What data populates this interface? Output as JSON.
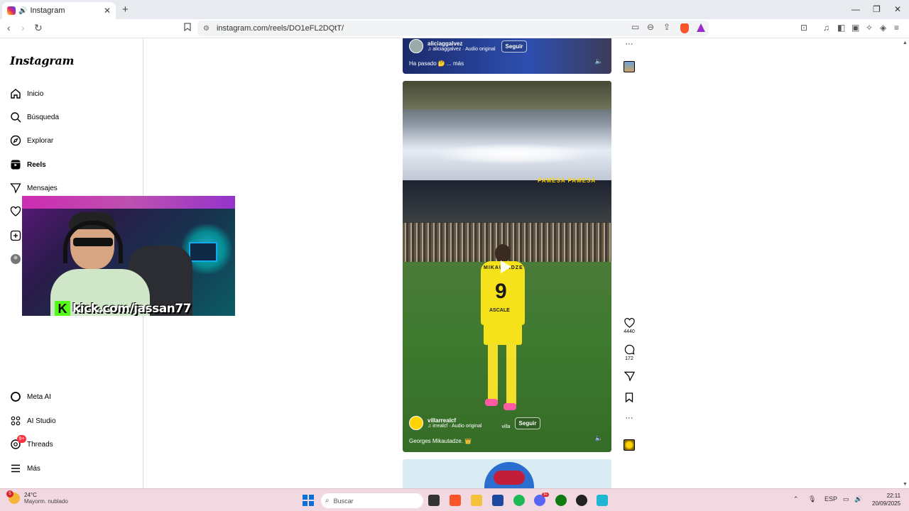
{
  "browser": {
    "tab_title": "Instagram",
    "url": "instagram.com/reels/DO1eFL2DQtT/",
    "new_tab_icon": "plus-icon",
    "accent": "#fb542b"
  },
  "sidebar": {
    "logo": "Instagram",
    "items": [
      {
        "label": "Inicio",
        "icon": "home-icon"
      },
      {
        "label": "Búsqueda",
        "icon": "search-icon"
      },
      {
        "label": "Explorar",
        "icon": "compass-icon"
      },
      {
        "label": "Reels",
        "icon": "reels-icon"
      },
      {
        "label": "Mensajes",
        "icon": "send-icon"
      }
    ],
    "bottom_items": [
      {
        "label": "Meta AI",
        "icon": "meta-ai-icon"
      },
      {
        "label": "AI Studio",
        "icon": "ai-studio-icon"
      },
      {
        "label": "Threads",
        "icon": "threads-icon",
        "badge": "9+"
      },
      {
        "label": "Más",
        "icon": "menu-icon"
      }
    ]
  },
  "overlay": {
    "kick_text": "kick.com/jassan77",
    "kick_color": "#53fc18"
  },
  "reels": {
    "top": {
      "username": "aliciaggalvez",
      "audio": "aliciaggalvez · Audio original",
      "follow": "Seguir",
      "caption": "Ha pasado 🤔 ... más"
    },
    "main": {
      "username": "villarrealcf",
      "audio": "irrealcf · Audio original",
      "extra": "villa",
      "follow": "Seguir",
      "caption": "Georges Mikautadze. 👑",
      "banner": "PAMESA PAMESA",
      "player_name": "MIKAUTADZE",
      "player_number": "9",
      "sponsor": "ASCALE",
      "likes": "4440",
      "comments": "172"
    }
  },
  "taskbar": {
    "temperature": "24°C",
    "weather": "Mayorm. nublado",
    "weather_badge": "5",
    "search_placeholder": "Buscar",
    "language": "ESP",
    "time": "22:11",
    "date": "20/09/2025",
    "discord_badge": "9+"
  }
}
